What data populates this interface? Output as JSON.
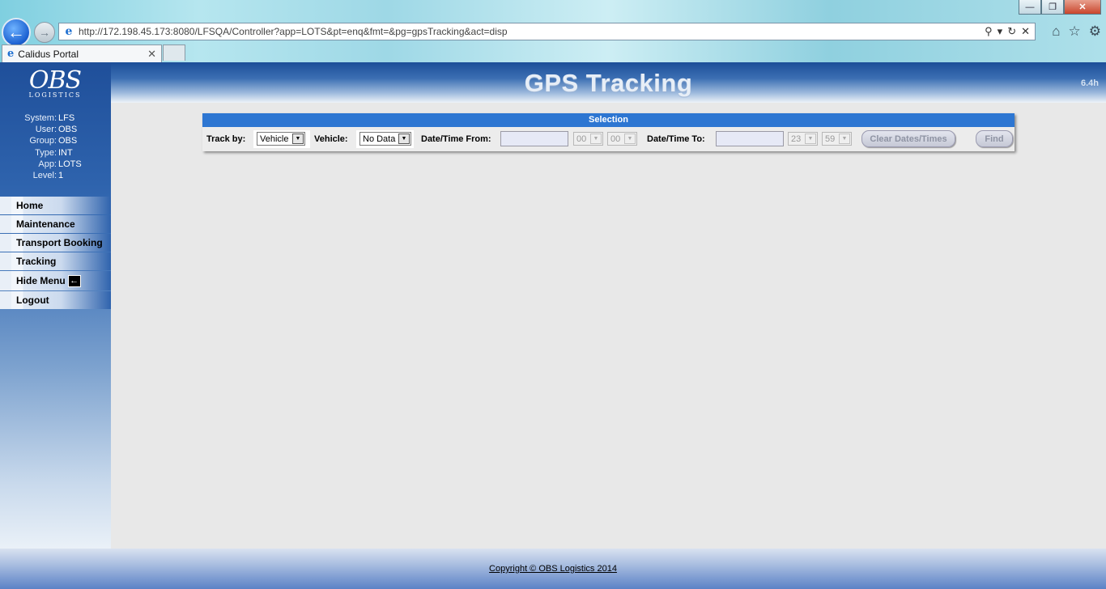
{
  "browser": {
    "url": "http://172.198.45.173:8080/LFSQA/Controller?app=LOTS&pt=enq&fmt=&pg=gpsTracking&act=disp",
    "tab_title": "Calidus Portal"
  },
  "sidebar": {
    "logo_main": "OBS",
    "logo_sub": "LOGISTICS",
    "info": [
      {
        "key": "System:",
        "value": "LFS"
      },
      {
        "key": "User:",
        "value": "OBS"
      },
      {
        "key": "Group:",
        "value": "OBS"
      },
      {
        "key": "Type:",
        "value": "INT"
      },
      {
        "key": "App:",
        "value": "LOTS"
      },
      {
        "key": "Level:",
        "value": "1"
      }
    ],
    "menu": {
      "home": "Home",
      "maintenance": "Maintenance",
      "transport_booking": "Transport Booking",
      "tracking": "Tracking",
      "hide_menu": "Hide Menu",
      "logout": "Logout"
    }
  },
  "header": {
    "title": "GPS Tracking",
    "version": "6.4h"
  },
  "selection": {
    "heading": "Selection",
    "track_by_label": "Track by:",
    "track_by_value": "Vehicle",
    "vehicle_label": "Vehicle:",
    "vehicle_value": "No Data",
    "from_label": "Date/Time From:",
    "from_hour": "00",
    "from_minute": "00",
    "to_label": "Date/Time To:",
    "to_hour": "23",
    "to_minute": "59",
    "clear_button": "Clear Dates/Times",
    "find_button": "Find"
  },
  "footer": {
    "copyright": "Copyright © OBS Logistics 2014"
  }
}
